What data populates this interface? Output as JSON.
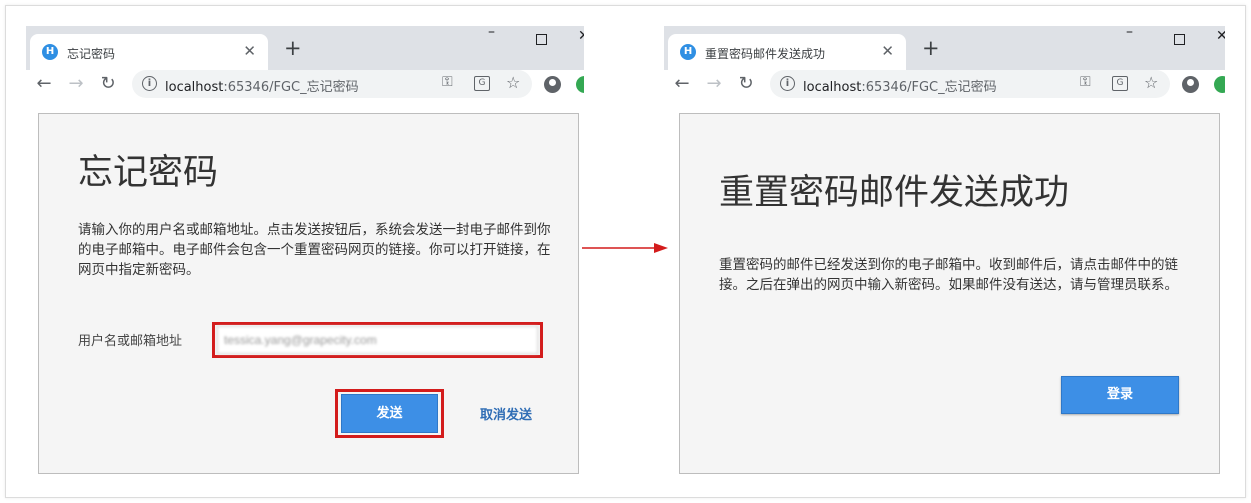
{
  "left_window": {
    "tab_title": "忘记密码",
    "favicon_letter": "H",
    "url_host": "localhost",
    "url_rest": ":65346/FGC_忘记密码",
    "page": {
      "heading": "忘记密码",
      "description": "请输入你的用户名或邮箱地址。点击发送按钮后，系统会发送一封电子邮件到你的电子邮箱中。电子邮件会包含一个重置密码网页的链接。你可以打开链接，在网页中指定新密码。",
      "field_label": "用户名或邮箱地址",
      "field_value": "tessica.yang@grapecity.com",
      "send_label": "发送",
      "cancel_label": "取消发送"
    }
  },
  "right_window": {
    "tab_title": "重置密码邮件发送成功",
    "favicon_letter": "H",
    "url_host": "localhost",
    "url_rest": ":65346/FGC_忘记密码",
    "page": {
      "heading": "重置密码邮件发送成功",
      "description": "重置密码的邮件已经发送到你的电子邮箱中。收到邮件后，请点击邮件中的链接。之后在弹出的网页中输入新密码。如果邮件没有送达，请与管理员联系。",
      "login_label": "登录"
    }
  },
  "colors": {
    "highlight_border": "#d31c1c",
    "primary_button": "#3d8fe6",
    "link_text": "#2f6db5",
    "arrow": "#d31c1c"
  }
}
